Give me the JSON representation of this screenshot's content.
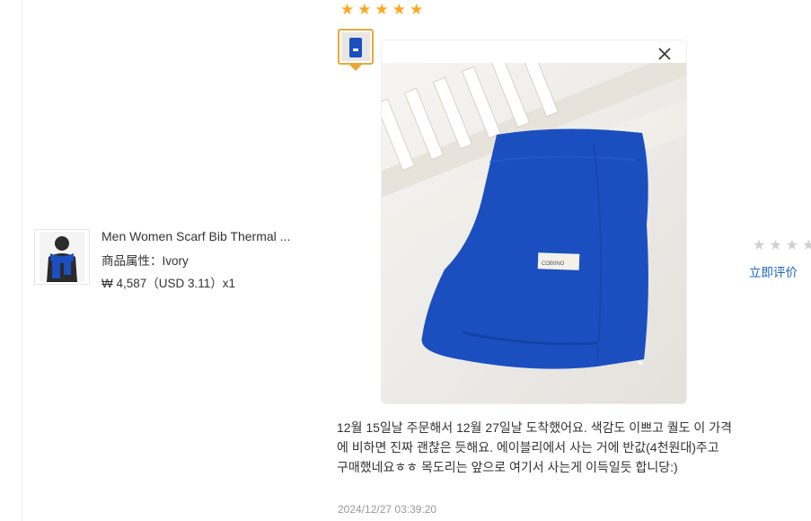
{
  "product": {
    "title": "Men Women Scarf Bib Thermal ...",
    "attribute": "商品属性：Ivory",
    "price": "₩ 4,587（USD  3.11）x1"
  },
  "review": {
    "rating": 5,
    "text": "12월 15일날 주문해서 12월 27일날 도착했어요. 색감도 이쁘고 퀄도 이 가격에 비하면 진짜 괜찮은 듯해요. 에이블리에서 사는 거에 반값(4천원대)주고 구매했네요ㅎㅎ 목도리는 앞으로 여기서 사는게 이득일듯 합니당:)",
    "date": "2024/12/27 03:39:20",
    "photo_label": "COBIINO"
  },
  "rate_action": {
    "label": "立即评价",
    "stars": 5
  },
  "icons": {
    "star": "star-icon",
    "close": "close-icon"
  },
  "colors": {
    "star_active": "#ffa51e",
    "star_inactive": "#cfcfcf",
    "link": "#1a66c4",
    "thumb_border": "#e8a838",
    "scarf": "#1b4fc0"
  }
}
